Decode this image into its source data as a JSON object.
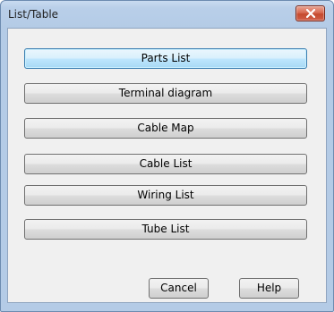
{
  "window": {
    "title": "List/Table"
  },
  "list_buttons": [
    {
      "label": "Parts List"
    },
    {
      "label": "Terminal diagram"
    },
    {
      "label": "Cable Map"
    },
    {
      "label": "Cable List"
    },
    {
      "label": "Wiring List"
    },
    {
      "label": "Tube List"
    }
  ],
  "footer": {
    "cancel_label": "Cancel",
    "help_label": "Help"
  },
  "icons": {
    "close": "close-icon"
  },
  "colors": {
    "close_button": "#c44a2e",
    "default_button_border": "#3c7fb1"
  }
}
